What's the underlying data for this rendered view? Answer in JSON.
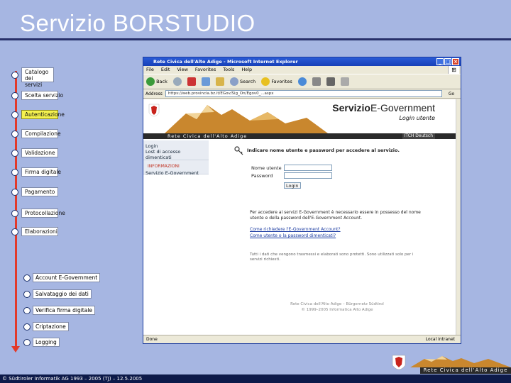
{
  "slide": {
    "title": "Servizio BORSTUDIO",
    "footer": "© Südtiroler Informatik AG 1993 – 2005   (TJ) – 12.5.2005"
  },
  "steps": [
    {
      "label": "Catalogo dei servizi",
      "active": false
    },
    {
      "label": "Scelta servizio",
      "active": false
    },
    {
      "label": "Autenticazione",
      "active": true
    },
    {
      "label": "Compilazione",
      "active": false
    },
    {
      "label": "Validazione",
      "active": false
    },
    {
      "label": "Firma digitale",
      "active": false
    },
    {
      "label": "Pagamento",
      "active": false
    },
    {
      "label": "Protocollazione",
      "active": false
    },
    {
      "label": "Elaborazioni",
      "active": false
    }
  ],
  "sub_steps": [
    {
      "label": "Account E-Government"
    },
    {
      "label": "Salvataggio dei dati"
    },
    {
      "label": "Verifica firma digitale"
    },
    {
      "label": "Criptazione"
    },
    {
      "label": "Logging"
    }
  ],
  "browser": {
    "title": "Rete Civica dell'Alto Adige - Microsoft Internet Explorer",
    "menu": [
      "File",
      "Edit",
      "View",
      "Favorites",
      "Tools",
      "Help"
    ],
    "toolbar": {
      "back": "Back",
      "search": "Search",
      "favorites": "Favorites"
    },
    "address_label": "Address",
    "address_value": "https://web.provincia.bz.it/EGov/Sig_On/Egov0_...aspx",
    "go_label": "Go",
    "status_left": "Done",
    "status_right": "Local intranet"
  },
  "page": {
    "brand_a": "Servizio",
    "brand_b": "E-Government",
    "subtitle": "Login utente",
    "band": "Rete Civica dell'Alto Adige",
    "lang": "ITCH Deutsch",
    "side_login": "Login",
    "side_lost": "Lost di accesso dimenticati",
    "side_info_label": "INFORMAZIONI",
    "side_service": "Servizio E-Government",
    "login_heading": "Indicare nome utente e password per accedere al servizio.",
    "user_label": "Nome utente",
    "password_label": "Password",
    "login_button": "Login",
    "info_text": "Per accedere ai servizi E-Government è necessario essere in possesso del nome utente e della password dell'E-Government Account.",
    "link_1": "Come richiedere l'E-Government Account?",
    "link_2": "Come utente o la password dimenticati?",
    "note_text": "Tutti i dati che vengono trasmessi e elaborati sono protetti. Sono utilizzati solo per i servizi richiesti.",
    "footer_text": "Rete Civica dell'Alto Adige – Bürgernetz Südtirol",
    "footer_text_2": "© 1999–2005 Informatica Alto Adige"
  },
  "brand_logo": {
    "text": "Rete Civica dell'Alto Adige"
  },
  "colors": {
    "background": "#a6b6e2",
    "active_step": "#f5f24e",
    "flow_arrow": "#e23a2a",
    "footer": "#0d1a4a"
  }
}
